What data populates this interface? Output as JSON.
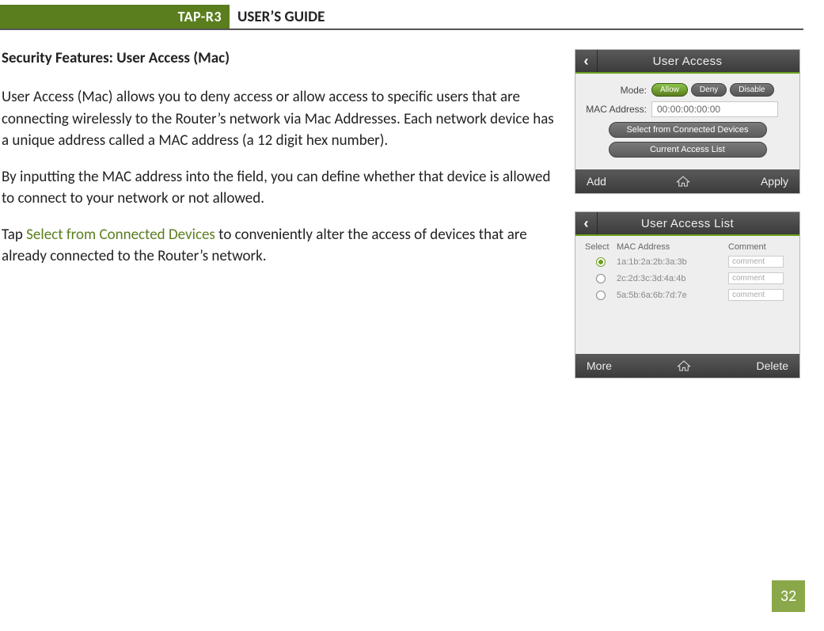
{
  "header": {
    "product": "TAP-R3",
    "doc_title": "USER’S GUIDE"
  },
  "section": {
    "title": "Security Features: User Access (Mac)",
    "para1": "User Access (Mac) allows you to deny access or allow access to specific users that are connecting wirelessly to the Router’s network via Mac Addresses. Each network device has a unique address called a MAC address (a 12 digit hex number).",
    "para2": "By inputting the MAC address into the field, you can define whether that device is allowed to connect to your network or not allowed.",
    "para3_pre": "Tap ",
    "para3_link": "Select from Connected Devices",
    "para3_post": " to conveniently alter the access of devices that are already connected to the Router’s network."
  },
  "fig1": {
    "title": "User Access",
    "mode_label": "Mode:",
    "mode_allow": "Allow",
    "mode_deny": "Deny",
    "mode_disable": "Disable",
    "mac_label": "MAC Address:",
    "mac_value": "00:00:00:00:00",
    "btn_select": "Select from Connected Devices",
    "btn_current": "Current Access List",
    "foot_left": "Add",
    "foot_right": "Apply"
  },
  "fig2": {
    "title": "User Access List",
    "col_select": "Select",
    "col_mac": "MAC Address",
    "col_comment": "Comment",
    "rows": [
      {
        "mac": "1a:1b:2a:2b:3a:3b",
        "comment": "comment",
        "selected": true
      },
      {
        "mac": "2c:2d:3c:3d:4a:4b",
        "comment": "comment",
        "selected": false
      },
      {
        "mac": "5a:5b:6a:6b:7d:7e",
        "comment": "comment",
        "selected": false
      }
    ],
    "foot_left": "More",
    "foot_right": "Delete"
  },
  "page_number": "32"
}
